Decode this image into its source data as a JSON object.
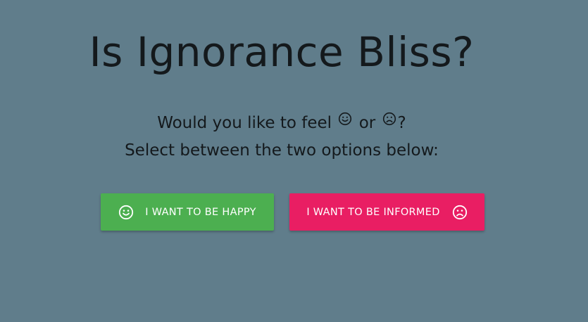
{
  "header": {
    "title": "Is Ignorance Bliss?"
  },
  "subtitle": {
    "line1_before": "Would you like to feel",
    "line1_middle": "or",
    "line1_after": "?",
    "line2": "Select between the two options below:"
  },
  "buttons": {
    "happy": {
      "label": "I WANT TO BE HAPPY",
      "icon": "smile-icon",
      "color": "#4caf50"
    },
    "informed": {
      "label": "I WANT TO BE INFORMED",
      "icon": "frown-icon",
      "color": "#e91e63"
    }
  },
  "colors": {
    "background": "#607d8b",
    "text": "#14191c"
  }
}
